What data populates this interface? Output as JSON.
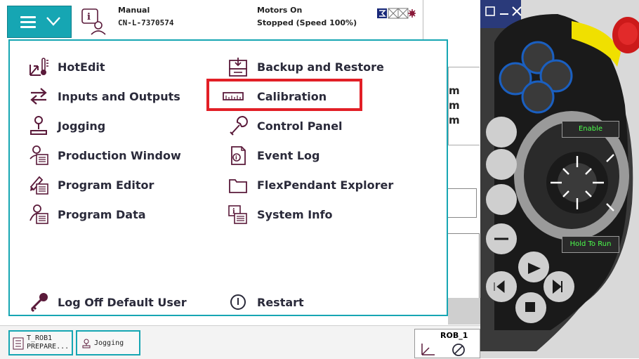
{
  "header": {
    "mode": "Manual",
    "controller": "CN-L-7370574",
    "motors_status": "Motors On",
    "run_status": "Stopped (Speed 100%)"
  },
  "menu": {
    "left": [
      {
        "label": "HotEdit",
        "icon": "hotedit-icon"
      },
      {
        "label": "Inputs and Outputs",
        "icon": "inputs-outputs-icon"
      },
      {
        "label": "Jogging",
        "icon": "jogging-icon"
      },
      {
        "label": "Production Window",
        "icon": "production-window-icon"
      },
      {
        "label": "Program Editor",
        "icon": "program-editor-icon"
      },
      {
        "label": "Program Data",
        "icon": "program-data-icon"
      }
    ],
    "right": [
      {
        "label": "Backup and Restore",
        "icon": "backup-restore-icon"
      },
      {
        "label": "Calibration",
        "icon": "calibration-icon"
      },
      {
        "label": "Control Panel",
        "icon": "control-panel-icon"
      },
      {
        "label": "Event Log",
        "icon": "event-log-icon"
      },
      {
        "label": "FlexPendant Explorer",
        "icon": "folder-icon"
      },
      {
        "label": "System Info",
        "icon": "system-info-icon"
      }
    ],
    "log_off": "Log Off Default User",
    "restart": "Restart"
  },
  "background_text": [
    "m",
    "m",
    "m"
  ],
  "taskbar": {
    "task1_line1": "T_ROB1",
    "task1_line2": "PREPARE...",
    "task2": "Jogging",
    "rob": "ROB_1"
  },
  "pendant": {
    "enable": "Enable",
    "hold_to_run": "Hold To Run"
  },
  "colors": {
    "accent": "#16a6b3",
    "highlight": "#e21f26",
    "icon": "#5a1a3a"
  }
}
